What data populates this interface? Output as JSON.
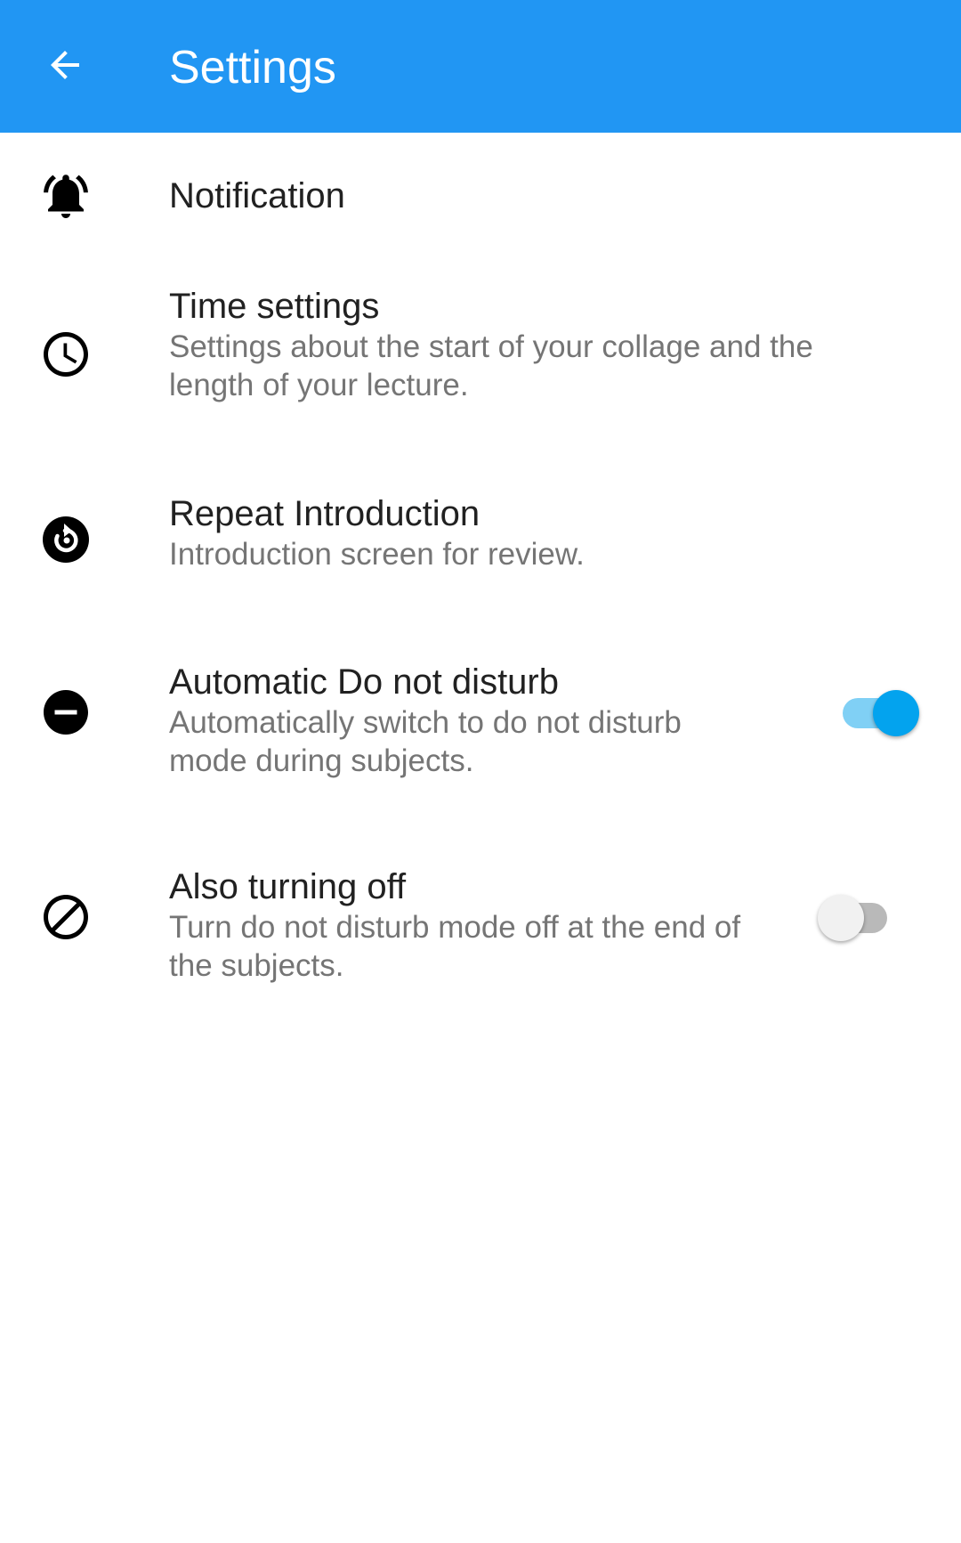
{
  "appbar": {
    "title": "Settings",
    "back_icon": "arrow-back-icon",
    "color": "#2196F3"
  },
  "settings": [
    {
      "title": "Notification",
      "icon": "bell-ringing-icon"
    },
    {
      "title": "Time settings",
      "summary": "Settings about the start of your collage and the length of your lecture.",
      "icon": "clock-icon"
    },
    {
      "title": "Repeat Introduction",
      "summary": "Introduction screen for review.",
      "icon": "replay-icon"
    },
    {
      "title": "Automatic Do not disturb",
      "summary": "Automatically switch to do not disturb mode during subjects.",
      "icon": "do-not-disturb-icon",
      "switch_on": true
    },
    {
      "title": "Also turning off",
      "summary": "Turn do not disturb mode off at the end of the subjects.",
      "icon": "block-icon",
      "switch_on": false
    }
  ],
  "colors": {
    "switch_on_thumb": "#03A3EE",
    "switch_on_track": "#80D0F5",
    "switch_off_thumb": "#F1F1F1",
    "switch_off_track": "#B9B9B9"
  }
}
